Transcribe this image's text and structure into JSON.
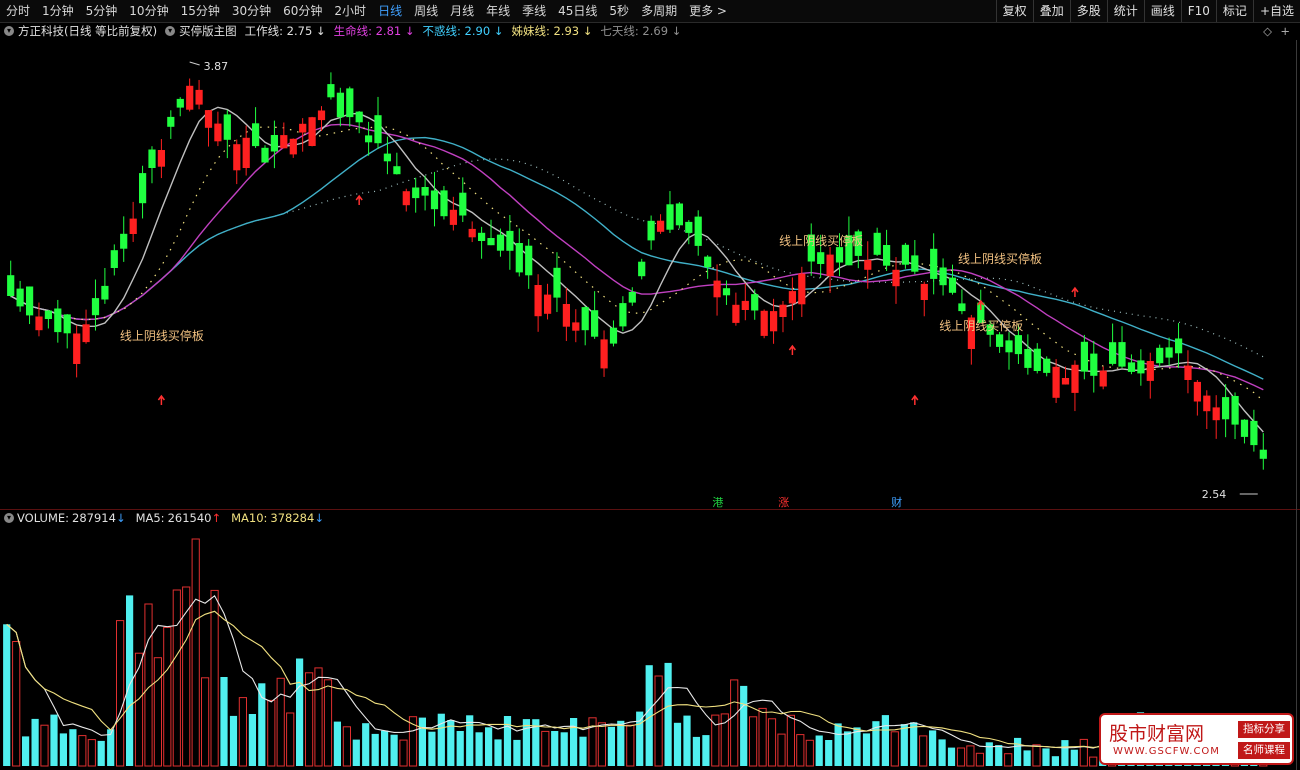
{
  "toolbar": {
    "timeframes": [
      "分时",
      "1分钟",
      "5分钟",
      "10分钟",
      "15分钟",
      "30分钟",
      "60分钟",
      "2小时",
      "日线",
      "周线",
      "月线",
      "年线",
      "季线",
      "45日线",
      "5秒",
      "多周期",
      "更多 >"
    ],
    "active": "日线",
    "right_buttons": [
      "复权",
      "叠加",
      "多股",
      "统计",
      "画线",
      "F10",
      "标记",
      "+自选"
    ]
  },
  "info": {
    "stock": "方正科技(日线 等比前复权)",
    "chart_name": "买停版主图",
    "lines": [
      {
        "label": "工作线:",
        "value": "2.75",
        "arrow": "↓",
        "color": "#e0e0e0"
      },
      {
        "label": "生命线:",
        "value": "2.81",
        "arrow": "↓",
        "color": "#e040e0"
      },
      {
        "label": "不惑线:",
        "value": "2.90",
        "arrow": "↓",
        "color": "#40d0ff"
      },
      {
        "label": "姊妹线:",
        "value": "2.93",
        "arrow": "↓",
        "color": "#f0e080"
      },
      {
        "label": "七天线:",
        "value": "2.69",
        "arrow": "↓",
        "color": "#909090"
      }
    ]
  },
  "annotations": {
    "high_label": "3.87",
    "low_label": "2.54",
    "signal_text": "线上阴线买停板",
    "markers": [
      {
        "text": "港",
        "color": "#20d040"
      },
      {
        "text": "涨",
        "color": "#ff3030"
      },
      {
        "text": "财",
        "color": "#3fa0ff"
      }
    ]
  },
  "volume": {
    "title": "VOLUME:",
    "value": "287914",
    "value_arrow": "↓",
    "ma5_label": "MA5:",
    "ma5": "261540",
    "ma5_arrow": "↑",
    "ma10_label": "MA10:",
    "ma10": "378284",
    "ma10_arrow": "↓"
  },
  "watermark": {
    "main": "股市财富网",
    "url": "WWW.GSCFW.COM",
    "tag1": "指标分享",
    "tag2": "名师课程"
  },
  "colors": {
    "up": "#ff2020",
    "down": "#20ff40",
    "work_line": "#c0c0c0",
    "life_line": "#c040c0",
    "buhuo_line": "#40b0c8",
    "sister_dots": "#f0e080",
    "seven_dots": "#a0c0c0",
    "vol_up": "#e03030",
    "vol_down": "#50f0f0"
  },
  "chart_data": {
    "type": "candlestick",
    "ylim": [
      2.54,
      3.87
    ],
    "price_keypoints": [
      [
        0,
        3.14
      ],
      [
        6,
        3.02
      ],
      [
        10,
        3.12
      ],
      [
        14,
        3.45
      ],
      [
        19,
        3.8
      ],
      [
        23,
        3.64
      ],
      [
        27,
        3.58
      ],
      [
        31,
        3.68
      ],
      [
        34,
        3.74
      ],
      [
        38,
        3.64
      ],
      [
        42,
        3.48
      ],
      [
        48,
        3.38
      ],
      [
        53,
        3.26
      ],
      [
        58,
        3.12
      ],
      [
        62,
        3.0
      ],
      [
        65,
        3.02
      ],
      [
        69,
        3.38
      ],
      [
        73,
        3.3
      ],
      [
        77,
        3.1
      ],
      [
        82,
        3.12
      ],
      [
        86,
        3.26
      ],
      [
        90,
        3.25
      ],
      [
        94,
        3.24
      ],
      [
        98,
        3.18
      ],
      [
        102,
        3.08
      ],
      [
        106,
        2.96
      ],
      [
        112,
        2.9
      ],
      [
        116,
        2.9
      ],
      [
        120,
        2.92
      ],
      [
        124,
        2.98
      ],
      [
        127,
        2.82
      ],
      [
        130,
        2.74
      ],
      [
        133,
        2.62
      ]
    ],
    "up_index_ranges": [
      [
        12,
        22
      ],
      [
        29,
        34
      ],
      [
        66,
        69
      ],
      [
        75,
        79
      ],
      [
        81,
        84
      ],
      [
        113,
        118
      ]
    ],
    "candle_count": 134,
    "volume_max": 1000000
  }
}
